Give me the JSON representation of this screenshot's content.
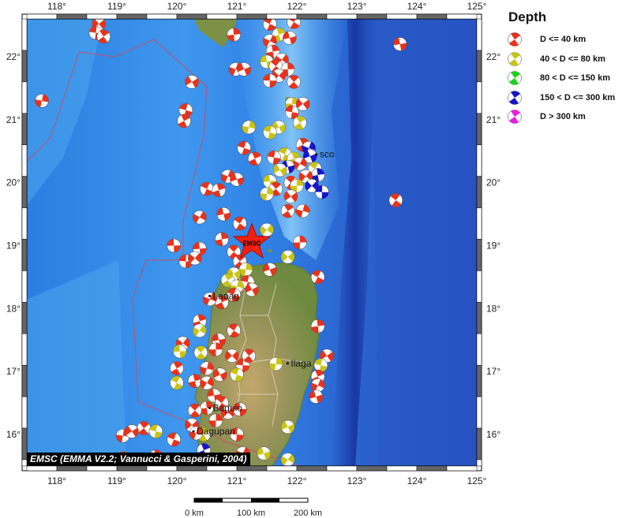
{
  "map": {
    "lon_ticks": [
      "118°",
      "119°",
      "120°",
      "121°",
      "122°",
      "123°",
      "124°",
      "125°"
    ],
    "lat_ticks": [
      "16°",
      "17°",
      "18°",
      "19°",
      "20°",
      "21°",
      "22°"
    ],
    "extent": {
      "lon_min": 117.5,
      "lon_max": 125.0,
      "lat_min": 15.5,
      "lat_max": 22.6
    },
    "colors": {
      "ocean_deep": "#1c3fb0",
      "ocean_mid": "#2f86e6",
      "ocean_shallow": "#7fc6f7",
      "land_low": "#6e8a3c",
      "land_high": "#c9a86a",
      "plate_boundary": "#c0506a"
    },
    "epicenter": {
      "lon": 121.25,
      "lat": 19.05,
      "label": "EMSC"
    },
    "place_labels": [
      {
        "text": "sco",
        "lon": 122.38,
        "lat": 20.45
      },
      {
        "text": "Laoag",
        "lon": 120.6,
        "lat": 18.2
      },
      {
        "text": "Ilaga",
        "lon": 121.9,
        "lat": 17.13
      },
      {
        "text": "Baguio",
        "lon": 120.6,
        "lat": 16.42
      },
      {
        "text": "Dagupan",
        "lon": 120.33,
        "lat": 16.05
      }
    ],
    "events": [
      {
        "lon": 118.7,
        "lat": 22.52,
        "d": "shallow"
      },
      {
        "lon": 118.65,
        "lat": 22.38,
        "d": "shallow"
      },
      {
        "lon": 118.78,
        "lat": 22.32,
        "d": "shallow"
      },
      {
        "lon": 117.75,
        "lat": 21.3,
        "d": "shallow"
      },
      {
        "lon": 120.25,
        "lat": 21.6,
        "d": "shallow"
      },
      {
        "lon": 120.15,
        "lat": 21.15,
        "d": "shallow"
      },
      {
        "lon": 120.12,
        "lat": 20.98,
        "d": "shallow"
      },
      {
        "lon": 120.98,
        "lat": 21.8,
        "d": "shallow"
      },
      {
        "lon": 121.12,
        "lat": 21.8,
        "d": "shallow"
      },
      {
        "lon": 121.55,
        "lat": 22.52,
        "d": "shallow"
      },
      {
        "lon": 121.7,
        "lat": 22.35,
        "d": "intermediate"
      },
      {
        "lon": 121.55,
        "lat": 22.25,
        "d": "shallow"
      },
      {
        "lon": 121.88,
        "lat": 22.3,
        "d": "shallow"
      },
      {
        "lon": 121.95,
        "lat": 22.55,
        "d": "shallow"
      },
      {
        "lon": 121.6,
        "lat": 22.08,
        "d": "shallow"
      },
      {
        "lon": 121.75,
        "lat": 21.95,
        "d": "shallow"
      },
      {
        "lon": 121.5,
        "lat": 21.92,
        "d": "intermediate"
      },
      {
        "lon": 121.65,
        "lat": 21.85,
        "d": "shallow"
      },
      {
        "lon": 121.85,
        "lat": 21.8,
        "d": "shallow"
      },
      {
        "lon": 121.7,
        "lat": 21.7,
        "d": "shallow"
      },
      {
        "lon": 121.55,
        "lat": 21.62,
        "d": "shallow"
      },
      {
        "lon": 121.95,
        "lat": 21.6,
        "d": "shallow"
      },
      {
        "lon": 121.92,
        "lat": 21.25,
        "d": "intermediate"
      },
      {
        "lon": 122.1,
        "lat": 21.25,
        "d": "shallow"
      },
      {
        "lon": 121.92,
        "lat": 21.12,
        "d": "shallow"
      },
      {
        "lon": 122.05,
        "lat": 20.95,
        "d": "intermediate"
      },
      {
        "lon": 121.2,
        "lat": 20.88,
        "d": "intermediate"
      },
      {
        "lon": 121.7,
        "lat": 20.88,
        "d": "intermediate"
      },
      {
        "lon": 121.55,
        "lat": 20.8,
        "d": "intermediate"
      },
      {
        "lon": 122.1,
        "lat": 20.6,
        "d": "shallow"
      },
      {
        "lon": 122.2,
        "lat": 20.55,
        "d": "deep"
      },
      {
        "lon": 122.22,
        "lat": 20.42,
        "d": "deep"
      },
      {
        "lon": 121.8,
        "lat": 20.45,
        "d": "intermediate"
      },
      {
        "lon": 121.95,
        "lat": 20.38,
        "d": "intermediate"
      },
      {
        "lon": 122.05,
        "lat": 20.3,
        "d": "shallow"
      },
      {
        "lon": 121.85,
        "lat": 20.25,
        "d": "deep"
      },
      {
        "lon": 122.3,
        "lat": 20.22,
        "d": "intermediate"
      },
      {
        "lon": 122.35,
        "lat": 20.12,
        "d": "deep"
      },
      {
        "lon": 122.15,
        "lat": 20.1,
        "d": "shallow"
      },
      {
        "lon": 121.55,
        "lat": 20.02,
        "d": "intermediate"
      },
      {
        "lon": 121.9,
        "lat": 20.0,
        "d": "shallow"
      },
      {
        "lon": 122.0,
        "lat": 19.95,
        "d": "intermediate"
      },
      {
        "lon": 122.25,
        "lat": 19.95,
        "d": "deep"
      },
      {
        "lon": 122.42,
        "lat": 19.85,
        "d": "deep"
      },
      {
        "lon": 121.65,
        "lat": 19.9,
        "d": "shallow"
      },
      {
        "lon": 121.5,
        "lat": 19.82,
        "d": "intermediate"
      },
      {
        "lon": 121.9,
        "lat": 19.78,
        "d": "shallow"
      },
      {
        "lon": 121.62,
        "lat": 20.4,
        "d": "shallow"
      },
      {
        "lon": 121.85,
        "lat": 19.55,
        "d": "shallow"
      },
      {
        "lon": 122.1,
        "lat": 19.55,
        "d": "shallow"
      },
      {
        "lon": 121.72,
        "lat": 20.2,
        "d": "intermediate"
      },
      {
        "lon": 121.12,
        "lat": 20.55,
        "d": "shallow"
      },
      {
        "lon": 121.3,
        "lat": 20.38,
        "d": "shallow"
      },
      {
        "lon": 120.85,
        "lat": 20.1,
        "d": "shallow"
      },
      {
        "lon": 121.0,
        "lat": 20.05,
        "d": "shallow"
      },
      {
        "lon": 120.5,
        "lat": 19.9,
        "d": "shallow"
      },
      {
        "lon": 120.7,
        "lat": 19.88,
        "d": "shallow"
      },
      {
        "lon": 120.38,
        "lat": 19.45,
        "d": "shallow"
      },
      {
        "lon": 120.78,
        "lat": 19.5,
        "d": "shallow"
      },
      {
        "lon": 121.05,
        "lat": 19.35,
        "d": "shallow"
      },
      {
        "lon": 120.75,
        "lat": 19.1,
        "d": "shallow"
      },
      {
        "lon": 121.5,
        "lat": 19.25,
        "d": "intermediate"
      },
      {
        "lon": 120.38,
        "lat": 18.95,
        "d": "shallow"
      },
      {
        "lon": 120.95,
        "lat": 18.9,
        "d": "shallow"
      },
      {
        "lon": 122.05,
        "lat": 19.05,
        "d": "shallow"
      },
      {
        "lon": 121.85,
        "lat": 18.82,
        "d": "intermediate"
      },
      {
        "lon": 120.15,
        "lat": 18.75,
        "d": "shallow"
      },
      {
        "lon": 121.05,
        "lat": 18.75,
        "d": "shallow"
      },
      {
        "lon": 121.15,
        "lat": 18.62,
        "d": "intermediate"
      },
      {
        "lon": 120.95,
        "lat": 18.55,
        "d": "intermediate"
      },
      {
        "lon": 121.18,
        "lat": 18.42,
        "d": "shallow"
      },
      {
        "lon": 120.85,
        "lat": 18.45,
        "d": "intermediate"
      },
      {
        "lon": 121.0,
        "lat": 18.35,
        "d": "intermediate"
      },
      {
        "lon": 121.25,
        "lat": 18.3,
        "d": "shallow"
      },
      {
        "lon": 120.95,
        "lat": 18.22,
        "d": "shallow"
      },
      {
        "lon": 120.75,
        "lat": 18.1,
        "d": "shallow"
      },
      {
        "lon": 120.55,
        "lat": 18.15,
        "d": "shallow"
      },
      {
        "lon": 121.55,
        "lat": 18.62,
        "d": "shallow"
      },
      {
        "lon": 122.35,
        "lat": 18.5,
        "d": "shallow"
      },
      {
        "lon": 120.38,
        "lat": 17.8,
        "d": "shallow"
      },
      {
        "lon": 120.38,
        "lat": 17.65,
        "d": "intermediate"
      },
      {
        "lon": 120.7,
        "lat": 17.5,
        "d": "shallow"
      },
      {
        "lon": 120.95,
        "lat": 17.65,
        "d": "shallow"
      },
      {
        "lon": 122.35,
        "lat": 17.72,
        "d": "shallow"
      },
      {
        "lon": 120.1,
        "lat": 17.45,
        "d": "shallow"
      },
      {
        "lon": 120.05,
        "lat": 17.32,
        "d": "intermediate"
      },
      {
        "lon": 120.4,
        "lat": 17.3,
        "d": "intermediate"
      },
      {
        "lon": 120.65,
        "lat": 17.35,
        "d": "shallow"
      },
      {
        "lon": 120.92,
        "lat": 17.25,
        "d": "shallow"
      },
      {
        "lon": 121.1,
        "lat": 17.1,
        "d": "shallow"
      },
      {
        "lon": 121.2,
        "lat": 17.25,
        "d": "shallow"
      },
      {
        "lon": 121.65,
        "lat": 17.12,
        "d": "intermediate"
      },
      {
        "lon": 122.5,
        "lat": 17.25,
        "d": "shallow"
      },
      {
        "lon": 122.4,
        "lat": 17.1,
        "d": "intermediate"
      },
      {
        "lon": 120.0,
        "lat": 17.05,
        "d": "shallow"
      },
      {
        "lon": 120.5,
        "lat": 17.05,
        "d": "shallow"
      },
      {
        "lon": 120.72,
        "lat": 16.95,
        "d": "shallow"
      },
      {
        "lon": 121.0,
        "lat": 16.95,
        "d": "intermediate"
      },
      {
        "lon": 122.35,
        "lat": 16.92,
        "d": "shallow"
      },
      {
        "lon": 122.35,
        "lat": 16.78,
        "d": "shallow"
      },
      {
        "lon": 122.32,
        "lat": 16.6,
        "d": "shallow"
      },
      {
        "lon": 120.0,
        "lat": 16.82,
        "d": "intermediate"
      },
      {
        "lon": 120.3,
        "lat": 16.85,
        "d": "shallow"
      },
      {
        "lon": 120.5,
        "lat": 16.82,
        "d": "shallow"
      },
      {
        "lon": 120.62,
        "lat": 16.62,
        "d": "shallow"
      },
      {
        "lon": 120.75,
        "lat": 16.5,
        "d": "shallow"
      },
      {
        "lon": 120.5,
        "lat": 16.42,
        "d": "shallow"
      },
      {
        "lon": 120.85,
        "lat": 16.35,
        "d": "shallow"
      },
      {
        "lon": 121.05,
        "lat": 16.4,
        "d": "shallow"
      },
      {
        "lon": 120.3,
        "lat": 16.38,
        "d": "shallow"
      },
      {
        "lon": 120.65,
        "lat": 16.22,
        "d": "shallow"
      },
      {
        "lon": 120.25,
        "lat": 16.15,
        "d": "shallow"
      },
      {
        "lon": 121.0,
        "lat": 16.0,
        "d": "shallow"
      },
      {
        "lon": 119.45,
        "lat": 16.1,
        "d": "shallow"
      },
      {
        "lon": 119.1,
        "lat": 15.98,
        "d": "shallow"
      },
      {
        "lon": 119.25,
        "lat": 16.05,
        "d": "shallow"
      },
      {
        "lon": 119.65,
        "lat": 16.05,
        "d": "intermediate"
      },
      {
        "lon": 120.45,
        "lat": 16.0,
        "d": "intermediate"
      },
      {
        "lon": 120.32,
        "lat": 16.02,
        "d": "shallow"
      },
      {
        "lon": 121.85,
        "lat": 16.12,
        "d": "intermediate"
      },
      {
        "lon": 119.95,
        "lat": 15.92,
        "d": "shallow"
      },
      {
        "lon": 120.45,
        "lat": 15.75,
        "d": "deep"
      },
      {
        "lon": 121.1,
        "lat": 15.7,
        "d": "shallow"
      },
      {
        "lon": 121.45,
        "lat": 15.7,
        "d": "intermediate"
      },
      {
        "lon": 119.1,
        "lat": 15.62,
        "d": "shallow"
      },
      {
        "lon": 119.65,
        "lat": 15.65,
        "d": "shallow"
      },
      {
        "lon": 121.85,
        "lat": 15.6,
        "d": "intermediate"
      },
      {
        "lon": 123.72,
        "lat": 22.2,
        "d": "shallow"
      },
      {
        "lon": 123.65,
        "lat": 19.72,
        "d": "shallow"
      },
      {
        "lon": 120.95,
        "lat": 22.35,
        "d": "shallow"
      },
      {
        "lon": 120.3,
        "lat": 18.8,
        "d": "shallow"
      },
      {
        "lon": 119.95,
        "lat": 19.0,
        "d": "shallow"
      }
    ]
  },
  "legend": {
    "title": "Depth",
    "items": [
      {
        "label": "D <= 40 km",
        "color": "#e8331c"
      },
      {
        "label": "40 < D <= 80 km",
        "color": "#c9c417"
      },
      {
        "label": "80 < D <= 150 km",
        "color": "#1fd11f"
      },
      {
        "label": "150 < D <= 300 km",
        "color": "#1616c8"
      },
      {
        "label": "D > 300 km",
        "color": "#e81ee0"
      }
    ]
  },
  "credit": "EMSC (EMMA V2.2; Vannucci & Gasperini, 2004)",
  "scale": {
    "labels": [
      "0 km",
      "100 km",
      "200 km"
    ]
  }
}
